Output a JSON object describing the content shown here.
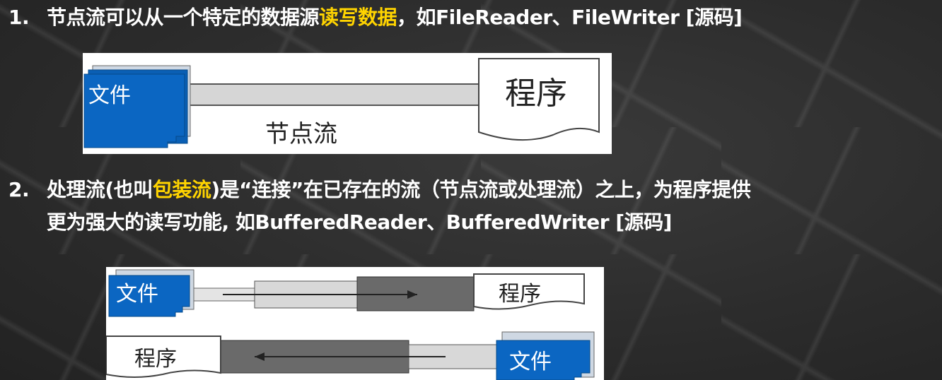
{
  "point1": {
    "num": "1.",
    "text_a": "节点流可以从一个特定的数据源",
    "highlight": "读写数据",
    "text_b": "，如FileReader、FileWriter [源码]"
  },
  "point2": {
    "num": "2.",
    "text_a": "处理流(也叫",
    "highlight": "包装流",
    "text_b": ")是“连接”在已存在的流（节点流或处理流）之上，为程序提供",
    "line2": "更为强大的读写功能, 如BufferedReader、BufferedWriter [源码]"
  },
  "fig1": {
    "file_label": "文件",
    "program_label": "程序",
    "stream_label": "节点流"
  },
  "fig2": {
    "top_file": "文件",
    "top_program": "程序",
    "bottom_program": "程序",
    "bottom_file": "文件"
  },
  "colors": {
    "highlight": "#ffd400",
    "file_blue": "#0a5fb4"
  }
}
